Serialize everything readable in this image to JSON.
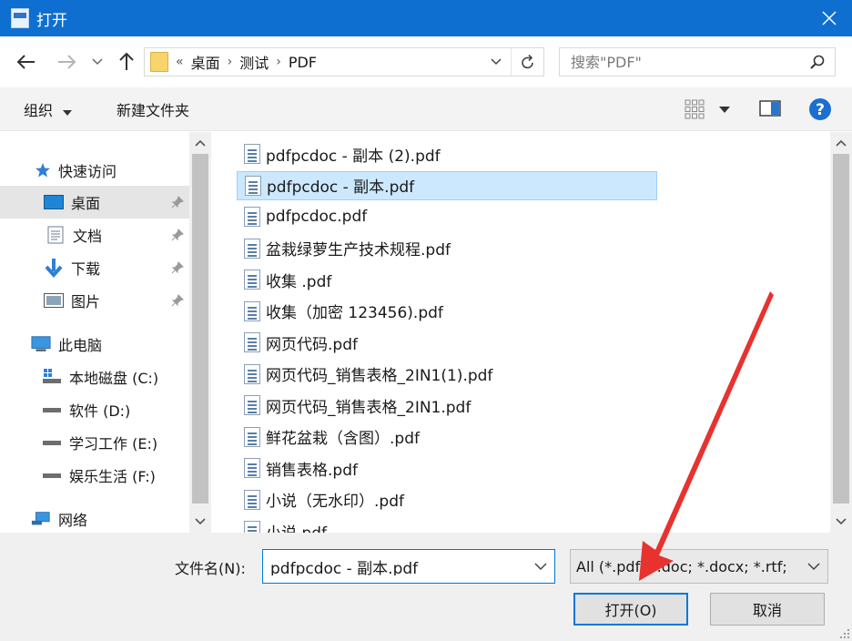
{
  "window": {
    "title": "打开"
  },
  "address": {
    "overflow": "«",
    "crumbs": [
      "桌面",
      "测试",
      "PDF"
    ]
  },
  "search": {
    "placeholder": "搜索\"PDF\""
  },
  "toolbar": {
    "organize": "组织",
    "new_folder": "新建文件夹"
  },
  "sidebar": {
    "items": [
      {
        "label": "快速访问",
        "icon": "star-icon"
      },
      {
        "label": "桌面",
        "icon": "desktop-icon",
        "selected": true
      },
      {
        "label": "文档",
        "icon": "document-icon"
      },
      {
        "label": "下载",
        "icon": "download-icon"
      },
      {
        "label": "图片",
        "icon": "picture-icon"
      },
      {
        "label": "此电脑",
        "icon": "computer-icon"
      },
      {
        "label": "本地磁盘 (C:)",
        "icon": "drive-icon"
      },
      {
        "label": "软件 (D:)",
        "icon": "drive-icon"
      },
      {
        "label": "学习工作 (E:)",
        "icon": "drive-icon"
      },
      {
        "label": "娱乐生活 (F:)",
        "icon": "drive-icon"
      },
      {
        "label": "网络",
        "icon": "network-icon"
      }
    ]
  },
  "files": [
    "pdfpcdoc - 副本 (2).pdf",
    "pdfpcdoc - 副本.pdf",
    "pdfpcdoc.pdf",
    "盆栽绿萝生产技术规程.pdf",
    "收集 .pdf",
    "收集（加密 123456).pdf",
    "网页代码.pdf",
    "网页代码_销售表格_2IN1(1).pdf",
    "网页代码_销售表格_2IN1.pdf",
    "鲜花盆栽（含图）.pdf",
    "销售表格.pdf",
    "小说（无水印）.pdf",
    "小说.pdf"
  ],
  "selected_file_index": 1,
  "bottom": {
    "filename_label": "文件名(N):",
    "filename_value": "pdfpcdoc - 副本.pdf",
    "filter_value": "All (*.pdf; *.doc; *.docx; *.rtf;",
    "open_label": "打开(O)",
    "cancel_label": "取消"
  },
  "colors": {
    "titlebar": "#0e6fd1",
    "selection": "#cce8ff",
    "annotation_arrow": "#e8322f"
  }
}
